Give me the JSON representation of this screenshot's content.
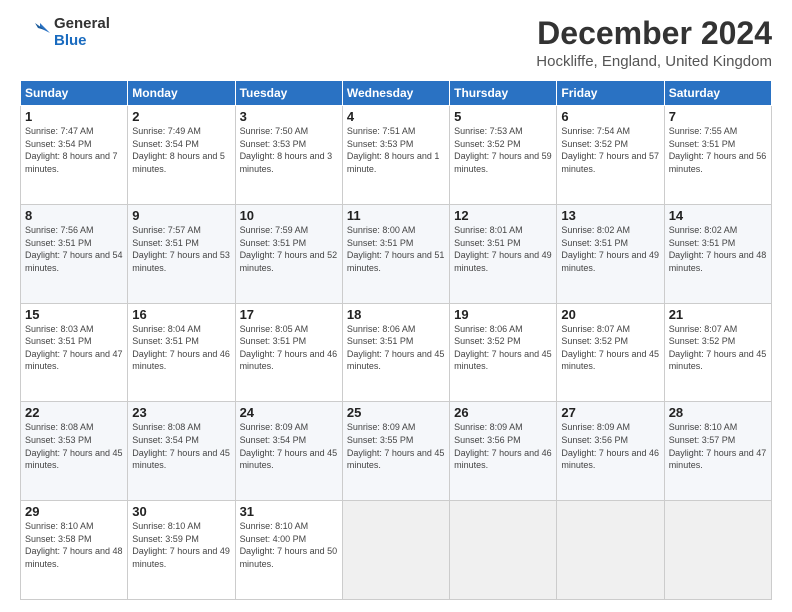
{
  "logo": {
    "general": "General",
    "blue": "Blue"
  },
  "title": "December 2024",
  "subtitle": "Hockliffe, England, United Kingdom",
  "headers": [
    "Sunday",
    "Monday",
    "Tuesday",
    "Wednesday",
    "Thursday",
    "Friday",
    "Saturday"
  ],
  "weeks": [
    [
      {
        "day": "1",
        "sunrise": "Sunrise: 7:47 AM",
        "sunset": "Sunset: 3:54 PM",
        "daylight": "Daylight: 8 hours and 7 minutes."
      },
      {
        "day": "2",
        "sunrise": "Sunrise: 7:49 AM",
        "sunset": "Sunset: 3:54 PM",
        "daylight": "Daylight: 8 hours and 5 minutes."
      },
      {
        "day": "3",
        "sunrise": "Sunrise: 7:50 AM",
        "sunset": "Sunset: 3:53 PM",
        "daylight": "Daylight: 8 hours and 3 minutes."
      },
      {
        "day": "4",
        "sunrise": "Sunrise: 7:51 AM",
        "sunset": "Sunset: 3:53 PM",
        "daylight": "Daylight: 8 hours and 1 minute."
      },
      {
        "day": "5",
        "sunrise": "Sunrise: 7:53 AM",
        "sunset": "Sunset: 3:52 PM",
        "daylight": "Daylight: 7 hours and 59 minutes."
      },
      {
        "day": "6",
        "sunrise": "Sunrise: 7:54 AM",
        "sunset": "Sunset: 3:52 PM",
        "daylight": "Daylight: 7 hours and 57 minutes."
      },
      {
        "day": "7",
        "sunrise": "Sunrise: 7:55 AM",
        "sunset": "Sunset: 3:51 PM",
        "daylight": "Daylight: 7 hours and 56 minutes."
      }
    ],
    [
      {
        "day": "8",
        "sunrise": "Sunrise: 7:56 AM",
        "sunset": "Sunset: 3:51 PM",
        "daylight": "Daylight: 7 hours and 54 minutes."
      },
      {
        "day": "9",
        "sunrise": "Sunrise: 7:57 AM",
        "sunset": "Sunset: 3:51 PM",
        "daylight": "Daylight: 7 hours and 53 minutes."
      },
      {
        "day": "10",
        "sunrise": "Sunrise: 7:59 AM",
        "sunset": "Sunset: 3:51 PM",
        "daylight": "Daylight: 7 hours and 52 minutes."
      },
      {
        "day": "11",
        "sunrise": "Sunrise: 8:00 AM",
        "sunset": "Sunset: 3:51 PM",
        "daylight": "Daylight: 7 hours and 51 minutes."
      },
      {
        "day": "12",
        "sunrise": "Sunrise: 8:01 AM",
        "sunset": "Sunset: 3:51 PM",
        "daylight": "Daylight: 7 hours and 49 minutes."
      },
      {
        "day": "13",
        "sunrise": "Sunrise: 8:02 AM",
        "sunset": "Sunset: 3:51 PM",
        "daylight": "Daylight: 7 hours and 49 minutes."
      },
      {
        "day": "14",
        "sunrise": "Sunrise: 8:02 AM",
        "sunset": "Sunset: 3:51 PM",
        "daylight": "Daylight: 7 hours and 48 minutes."
      }
    ],
    [
      {
        "day": "15",
        "sunrise": "Sunrise: 8:03 AM",
        "sunset": "Sunset: 3:51 PM",
        "daylight": "Daylight: 7 hours and 47 minutes."
      },
      {
        "day": "16",
        "sunrise": "Sunrise: 8:04 AM",
        "sunset": "Sunset: 3:51 PM",
        "daylight": "Daylight: 7 hours and 46 minutes."
      },
      {
        "day": "17",
        "sunrise": "Sunrise: 8:05 AM",
        "sunset": "Sunset: 3:51 PM",
        "daylight": "Daylight: 7 hours and 46 minutes."
      },
      {
        "day": "18",
        "sunrise": "Sunrise: 8:06 AM",
        "sunset": "Sunset: 3:51 PM",
        "daylight": "Daylight: 7 hours and 45 minutes."
      },
      {
        "day": "19",
        "sunrise": "Sunrise: 8:06 AM",
        "sunset": "Sunset: 3:52 PM",
        "daylight": "Daylight: 7 hours and 45 minutes."
      },
      {
        "day": "20",
        "sunrise": "Sunrise: 8:07 AM",
        "sunset": "Sunset: 3:52 PM",
        "daylight": "Daylight: 7 hours and 45 minutes."
      },
      {
        "day": "21",
        "sunrise": "Sunrise: 8:07 AM",
        "sunset": "Sunset: 3:52 PM",
        "daylight": "Daylight: 7 hours and 45 minutes."
      }
    ],
    [
      {
        "day": "22",
        "sunrise": "Sunrise: 8:08 AM",
        "sunset": "Sunset: 3:53 PM",
        "daylight": "Daylight: 7 hours and 45 minutes."
      },
      {
        "day": "23",
        "sunrise": "Sunrise: 8:08 AM",
        "sunset": "Sunset: 3:54 PM",
        "daylight": "Daylight: 7 hours and 45 minutes."
      },
      {
        "day": "24",
        "sunrise": "Sunrise: 8:09 AM",
        "sunset": "Sunset: 3:54 PM",
        "daylight": "Daylight: 7 hours and 45 minutes."
      },
      {
        "day": "25",
        "sunrise": "Sunrise: 8:09 AM",
        "sunset": "Sunset: 3:55 PM",
        "daylight": "Daylight: 7 hours and 45 minutes."
      },
      {
        "day": "26",
        "sunrise": "Sunrise: 8:09 AM",
        "sunset": "Sunset: 3:56 PM",
        "daylight": "Daylight: 7 hours and 46 minutes."
      },
      {
        "day": "27",
        "sunrise": "Sunrise: 8:09 AM",
        "sunset": "Sunset: 3:56 PM",
        "daylight": "Daylight: 7 hours and 46 minutes."
      },
      {
        "day": "28",
        "sunrise": "Sunrise: 8:10 AM",
        "sunset": "Sunset: 3:57 PM",
        "daylight": "Daylight: 7 hours and 47 minutes."
      }
    ],
    [
      {
        "day": "29",
        "sunrise": "Sunrise: 8:10 AM",
        "sunset": "Sunset: 3:58 PM",
        "daylight": "Daylight: 7 hours and 48 minutes."
      },
      {
        "day": "30",
        "sunrise": "Sunrise: 8:10 AM",
        "sunset": "Sunset: 3:59 PM",
        "daylight": "Daylight: 7 hours and 49 minutes."
      },
      {
        "day": "31",
        "sunrise": "Sunrise: 8:10 AM",
        "sunset": "Sunset: 4:00 PM",
        "daylight": "Daylight: 7 hours and 50 minutes."
      },
      null,
      null,
      null,
      null
    ]
  ]
}
